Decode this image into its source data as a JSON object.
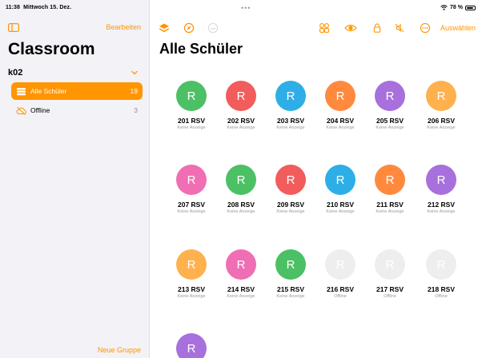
{
  "status": {
    "time": "11:38",
    "date": "Mittwoch 15. Dez.",
    "battery": "78 %"
  },
  "sidebar": {
    "edit_label": "Bearbeiten",
    "title": "Classroom",
    "group_name": "k02",
    "items": [
      {
        "label": "Alle Schüler",
        "count": "19",
        "icon": "stack-icon"
      },
      {
        "label": "Offline",
        "count": "3",
        "icon": "cloud-offline-icon"
      }
    ],
    "new_group_label": "Neue Gruppe"
  },
  "main": {
    "title": "Alle Schüler",
    "select_label": "Auswählen",
    "toolbar_icons": [
      "layers-icon",
      "compass-icon",
      "inbox-icon",
      "grid-icon",
      "eye-icon",
      "lock-icon",
      "mute-icon",
      "more-icon"
    ],
    "students": [
      {
        "initial": "R",
        "name": "201 RSV",
        "status": "Keine Anzeige",
        "color": "#4cc064"
      },
      {
        "initial": "R",
        "name": "202 RSV",
        "status": "Keine Anzeige",
        "color": "#f25c5c"
      },
      {
        "initial": "R",
        "name": "203 RSV",
        "status": "Keine Anzeige",
        "color": "#2eaee6"
      },
      {
        "initial": "R",
        "name": "204 RSV",
        "status": "Keine Anzeige",
        "color": "#ff8a3d"
      },
      {
        "initial": "R",
        "name": "205 RSV",
        "status": "Keine Anzeige",
        "color": "#a770dc"
      },
      {
        "initial": "R",
        "name": "206 RSV",
        "status": "Keine Anzeige",
        "color": "#ffb14e"
      },
      {
        "initial": "R",
        "name": "207 RSV",
        "status": "Keine Anzeige",
        "color": "#f06eb4"
      },
      {
        "initial": "R",
        "name": "208 RSV",
        "status": "Keine Anzeige",
        "color": "#4cc064"
      },
      {
        "initial": "R",
        "name": "209 RSV",
        "status": "Keine Anzeige",
        "color": "#f25c5c"
      },
      {
        "initial": "R",
        "name": "210 RSV",
        "status": "Keine Anzeige",
        "color": "#2eaee6"
      },
      {
        "initial": "R",
        "name": "211 RSV",
        "status": "Keine Anzeige",
        "color": "#ff8a3d"
      },
      {
        "initial": "R",
        "name": "212 RSV",
        "status": "Keine Anzeige",
        "color": "#a770dc"
      },
      {
        "initial": "R",
        "name": "213 RSV",
        "status": "Keine Anzeige",
        "color": "#ffb14e"
      },
      {
        "initial": "R",
        "name": "214 RSV",
        "status": "Keine Anzeige",
        "color": "#f06eb4"
      },
      {
        "initial": "R",
        "name": "215 RSV",
        "status": "Keine Anzeige",
        "color": "#4cc064"
      },
      {
        "initial": "R",
        "name": "216 RSV",
        "status": "Offline",
        "color": "#eeeeef"
      },
      {
        "initial": "R",
        "name": "217 RSV",
        "status": "Offline",
        "color": "#eeeeef"
      },
      {
        "initial": "R",
        "name": "218 RSV",
        "status": "Offline",
        "color": "#eeeeef"
      },
      {
        "initial": "R",
        "name": "",
        "status": "",
        "color": "#a770dc"
      }
    ]
  },
  "colors": {
    "accent": "#ff9500",
    "sidebar_bg": "#f2f2f7"
  }
}
